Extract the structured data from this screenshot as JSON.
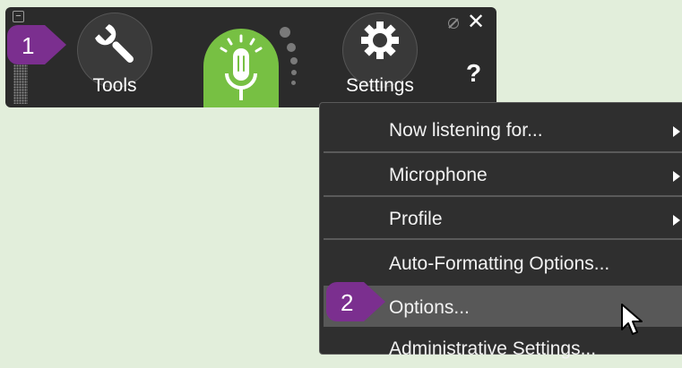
{
  "document": {
    "prefix": "___",
    "middle": " ... ... ... ... ... ... ... ... ... ... ... ... ... ... ...",
    "suffix": "______________"
  },
  "toolbar": {
    "minimize_label": "−",
    "tools_label": "Tools",
    "settings_label": "Settings",
    "help_label": "?",
    "close_label": "✕",
    "mic_state": "listening",
    "mic_color": "#77c043",
    "background_color": "#2b2b2b"
  },
  "callouts": {
    "step1": "1",
    "step2": "2",
    "color": "#7b2f8f"
  },
  "context_menu": {
    "items": [
      {
        "label": "Now listening for...",
        "submenu": true
      },
      {
        "label": "Microphone",
        "submenu": true
      },
      {
        "label": "Profile",
        "submenu": true
      },
      {
        "label": "Auto-Formatting Options...",
        "submenu": false
      },
      {
        "label": "Options...",
        "submenu": false,
        "highlighted": true
      },
      {
        "label": "Administrative Settings...",
        "submenu": false
      }
    ]
  }
}
